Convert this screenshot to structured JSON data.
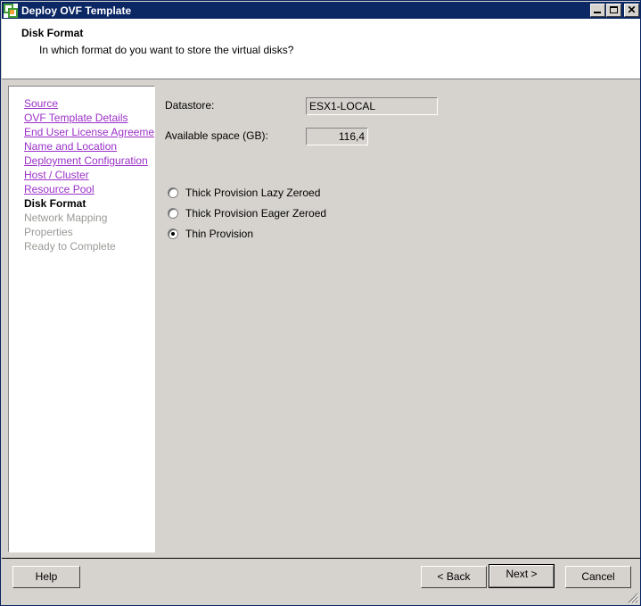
{
  "window": {
    "title": "Deploy OVF Template",
    "icon": "ovf-template-icon",
    "controls": {
      "minimize": "Minimize",
      "maximize": "Maximize",
      "close": "Close"
    }
  },
  "header": {
    "title": "Disk Format",
    "subtitle": "In which format do you want to store the virtual disks?"
  },
  "sidebar": {
    "items": [
      {
        "label": "Source",
        "state": "done"
      },
      {
        "label": "OVF Template Details",
        "state": "done"
      },
      {
        "label": "End User License Agreement",
        "state": "done"
      },
      {
        "label": "Name and Location",
        "state": "done"
      },
      {
        "label": "Deployment Configuration",
        "state": "done"
      },
      {
        "label": "Host / Cluster",
        "state": "done"
      },
      {
        "label": "Resource Pool",
        "state": "done"
      },
      {
        "label": "Disk Format",
        "state": "current"
      },
      {
        "label": "Network Mapping",
        "state": "future"
      },
      {
        "label": "Properties",
        "state": "future"
      },
      {
        "label": "Ready to Complete",
        "state": "future"
      }
    ]
  },
  "form": {
    "datastore": {
      "label": "Datastore:",
      "value": "ESX1-LOCAL"
    },
    "available_space": {
      "label": "Available space (GB):",
      "value": "116,4"
    },
    "disk_format": {
      "selected": "Thin Provision",
      "options": [
        {
          "label": "Thick Provision Lazy Zeroed",
          "selected": false
        },
        {
          "label": "Thick Provision Eager Zeroed",
          "selected": false
        },
        {
          "label": "Thin Provision",
          "selected": true
        }
      ]
    }
  },
  "footer": {
    "help": "Help",
    "back": "< Back",
    "next": "Next >",
    "cancel": "Cancel"
  },
  "colors": {
    "titlebar": "#0b2764",
    "dialog_face": "#d6d3ce",
    "link": "#9b30c8",
    "disabled_text": "#9a9a96"
  }
}
